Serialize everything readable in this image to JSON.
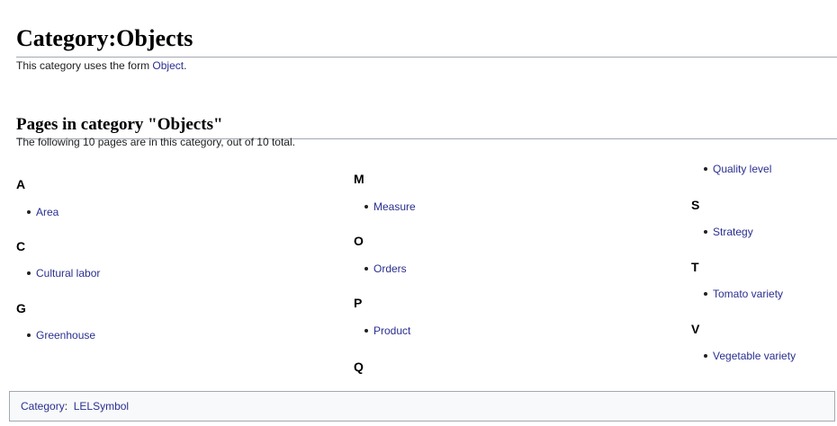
{
  "page": {
    "title": "Category:Objects",
    "form_note_prefix": "This category uses the form ",
    "form_link": "Object",
    "form_note_suffix": "."
  },
  "section": {
    "heading": "Pages in category \"Objects\"",
    "count_note": "The following 10 pages are in this category, out of 10 total."
  },
  "columns": [
    {
      "groups": [
        {
          "letter": "A",
          "items": [
            "Area"
          ]
        },
        {
          "letter": "C",
          "items": [
            "Cultural labor"
          ]
        },
        {
          "letter": "G",
          "items": [
            "Greenhouse"
          ]
        }
      ]
    },
    {
      "groups": [
        {
          "letter": "M",
          "items": [
            "Measure"
          ]
        },
        {
          "letter": "O",
          "items": [
            "Orders"
          ]
        },
        {
          "letter": "P",
          "items": [
            "Product"
          ]
        },
        {
          "letter": "Q",
          "items": []
        }
      ]
    },
    {
      "continued_items": [
        "Quality level"
      ],
      "groups": [
        {
          "letter": "S",
          "items": [
            "Strategy"
          ]
        },
        {
          "letter": "T",
          "items": [
            "Tomato variety"
          ]
        },
        {
          "letter": "V",
          "items": [
            "Vegetable variety"
          ]
        }
      ]
    }
  ],
  "catlinks": {
    "label": "Category",
    "separator": ":",
    "links": [
      "LELSymbol"
    ]
  },
  "colors": {
    "link": "#2a2f8f",
    "text": "#202122",
    "border": "#a2a9b1",
    "catlinks_bg": "#f8f9fa"
  }
}
